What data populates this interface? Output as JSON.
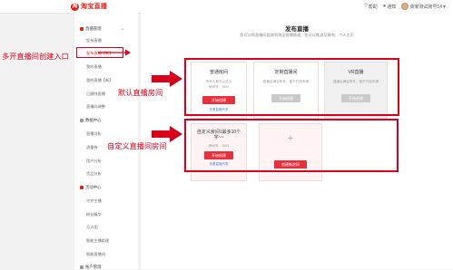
{
  "header": {
    "logo_text": "淘宝直播",
    "help": "帮助",
    "notify": "通知",
    "username": "商家测试账号14"
  },
  "sidebar": {
    "sections": [
      {
        "label": "直播管理",
        "items": [
          "发布直播",
          "发布直播【新】",
          "我的直播",
          "我的直播【新】",
          "已删除直播",
          "直播间调整"
        ]
      },
      {
        "label": "数据中心",
        "items": [
          "直播详析",
          "流量券",
          "用户分析",
          "货品分析"
        ]
      },
      {
        "label": "活动中心",
        "items": [
          "守护主播",
          "粉丝精华",
          "万人团",
          "智能主播助理",
          "智能直播间"
        ]
      },
      {
        "label": "账户管理",
        "items": []
      }
    ]
  },
  "main": {
    "title": "发布直播",
    "subtitle": "您可以将直播间投放到淘宝直播频道、也可以推送至微淘、个人主页",
    "cards_row1": [
      {
        "title": "普通房间",
        "desc1": "所有人都可以进入",
        "desc2": "房间号：7803",
        "button": "开始创建",
        "link": "查看直播列表",
        "disabled": false
      },
      {
        "title": "定制直播间",
        "desc1": "直播后满足条件，暂不开放申请",
        "desc2": "",
        "button": "开始创建",
        "link": "",
        "disabled": true
      },
      {
        "title": "VR直播",
        "desc1": "直播后满足条件，暂不开放申请",
        "desc2": "",
        "button": "开始创建",
        "link": "",
        "disabled": true
      }
    ],
    "cards_row2": [
      {
        "title": "自定义房间1最多10个字~~",
        "desc": "房间号：7803",
        "button": "开始创建",
        "link": "查看直播列表"
      },
      {
        "plus": "+",
        "button": "创建新房间"
      }
    ]
  },
  "annotations": {
    "entry": "多开直播间创建入口",
    "default_room": "默认直播房间",
    "custom_room": "自定义直播间房间"
  },
  "colors": {
    "accent": "#e2231a",
    "annotation": "#d9001b",
    "button": "#e8303d"
  }
}
